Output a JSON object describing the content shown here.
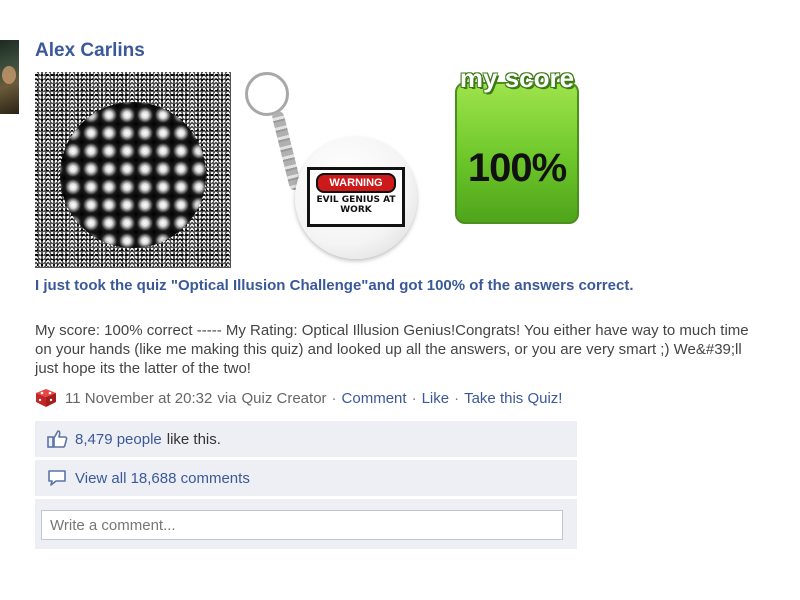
{
  "post": {
    "author": "Alex Carlins",
    "headline": "I just took the quiz \"Optical Illusion Challenge\"and got 100% of the answers correct.",
    "description": "My score: 100% correct ----- My Rating: Optical Illusion Genius!Congrats! You either have way to much time on your hands (like me making this quiz) and looked up all the answers, or you are very smart ;) We&#39;ll just hope its the latter of the two!",
    "attachments": {
      "warning_label": "WARNING",
      "warning_text": "EVIL GENIUS AT WORK",
      "score_title": "my score",
      "score_value": "100%"
    },
    "meta": {
      "timestamp": "11 November at 20:32",
      "via_prefix": "via",
      "app_name": "Quiz Creator",
      "separator": "·",
      "comment_link": "Comment",
      "like_link": "Like",
      "take_quiz_link": "Take this Quiz!"
    }
  },
  "likes": {
    "count_link": "8,479 people",
    "suffix": "like this."
  },
  "comments": {
    "view_all": "View all 18,688 comments",
    "placeholder": "Write a comment..."
  },
  "colors": {
    "link": "#3b5998",
    "ufi_background": "#edeff4",
    "app_icon": "#d22b2b"
  },
  "icons": {
    "app": "red-cube-icon",
    "like": "thumbs-up-icon",
    "comments": "speech-bubble-icon"
  }
}
